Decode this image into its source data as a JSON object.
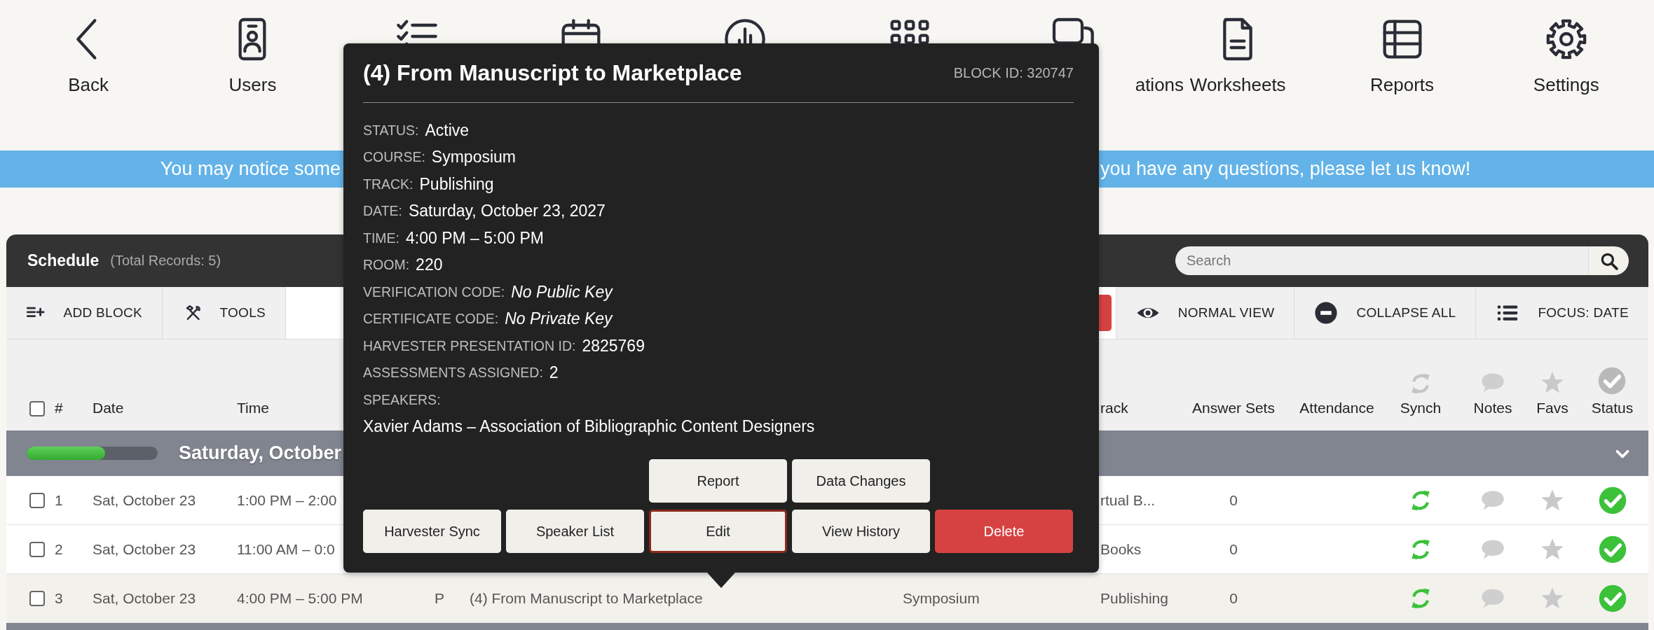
{
  "nav": [
    {
      "kind": "labeled",
      "label": "Back"
    },
    {
      "kind": "labeled",
      "label": "Users"
    },
    {
      "kind": "icon_only"
    },
    {
      "kind": "icon_only"
    },
    {
      "kind": "icon_only"
    },
    {
      "kind": "icon_only"
    },
    {
      "kind": "cut_label",
      "label": "ations"
    },
    {
      "kind": "labeled",
      "label": "Worksheets"
    },
    {
      "kind": "labeled",
      "label": "Reports"
    },
    {
      "kind": "labeled",
      "label": "Settings"
    }
  ],
  "banner": {
    "text_before": "You may notice some",
    "text_after": "you have any questions, please let us know!"
  },
  "schedule": {
    "title": "Schedule",
    "total": "(Total Records: 5)",
    "search": {
      "placeholder": "Search"
    },
    "toolbar_left": [
      {
        "label": "ADD BLOCK"
      },
      {
        "label": "TOOLS"
      }
    ],
    "toolbar_right": [
      {
        "kind": "danger"
      },
      {
        "kind": "plain",
        "label": "NORMAL VIEW"
      },
      {
        "kind": "plain",
        "label": "COLLAPSE ALL"
      },
      {
        "kind": "plain",
        "label": "FOCUS: DATE"
      }
    ],
    "select_all": {
      "checked": false
    },
    "columns": {
      "number": "#",
      "date": "Date",
      "time": "Time",
      "track": "rack",
      "answer_sets": "Answer Sets",
      "attendance": "Attendance",
      "synch": "Synch",
      "notes": "Notes",
      "favs": "Favs",
      "status": "Status"
    },
    "group": {
      "label": "Saturday, October",
      "level": 0.6,
      "expanded": true
    },
    "rows": [
      {
        "checked": false,
        "highlighted": false,
        "number": "1",
        "date": "Sat, October 23",
        "time": "1:00 PM – 2:00",
        "track": "rtual B...",
        "answer_sets": "0",
        "synched": true,
        "has_notes": false,
        "favorite": false,
        "complete": true
      },
      {
        "checked": false,
        "highlighted": false,
        "number": "2",
        "date": "Sat, October 23",
        "time": "11:00 AM – 0:0",
        "track": "Books",
        "answer_sets": "0",
        "synched": true,
        "has_notes": false,
        "favorite": false,
        "complete": true
      },
      {
        "checked": false,
        "highlighted": true,
        "number": "3",
        "date": "Sat, October 23",
        "time": "4:00 PM – 5:00 PM",
        "type": "P",
        "title": "(4) From Manuscript to Marketplace",
        "course": "Symposium",
        "track": "Publishing",
        "answer_sets": "0",
        "synched": true,
        "has_notes": false,
        "favorite": false,
        "complete": true
      }
    ]
  },
  "popup": {
    "title": "(4) From Manuscript to Marketplace",
    "block_id": "BLOCK ID: 320747",
    "fields": [
      {
        "label": "STATUS:",
        "value": "Active",
        "italic": false
      },
      {
        "label": "COURSE:",
        "value": "Symposium",
        "italic": false
      },
      {
        "label": "TRACK:",
        "value": "Publishing",
        "italic": false
      },
      {
        "label": "DATE:",
        "value": "Saturday, October 23, 2027",
        "italic": false
      },
      {
        "label": "TIME:",
        "value": "4:00 PM – 5:00 PM",
        "italic": false
      },
      {
        "label": "ROOM:",
        "value": "220",
        "italic": false
      },
      {
        "label": "VERIFICATION CODE:",
        "value": "No Public Key",
        "italic": true
      },
      {
        "label": "CERTIFICATE CODE:",
        "value": "No Private Key",
        "italic": true
      },
      {
        "label": "HARVESTER PRESENTATION ID:",
        "value": "2825769",
        "italic": false
      },
      {
        "label": "ASSESSMENTS ASSIGNED:",
        "value": "2",
        "italic": false
      }
    ],
    "speakers_label": "SPEAKERS:",
    "speakers": [
      "Xavier Adams – Association of Bibliographic Content Designers"
    ],
    "buttons": [
      [
        {
          "label": "Report",
          "kind": "plain",
          "focused": false
        },
        {
          "label": "Data Changes",
          "kind": "plain",
          "focused": false
        }
      ],
      [
        {
          "label": "Harvester Sync",
          "kind": "plain",
          "focused": false
        },
        {
          "label": "Speaker List",
          "kind": "plain",
          "focused": false
        },
        {
          "label": "Edit",
          "kind": "plain",
          "focused": true
        },
        {
          "label": "View History",
          "kind": "plain",
          "focused": false
        },
        {
          "label": "Delete",
          "kind": "danger",
          "focused": false
        }
      ]
    ]
  }
}
